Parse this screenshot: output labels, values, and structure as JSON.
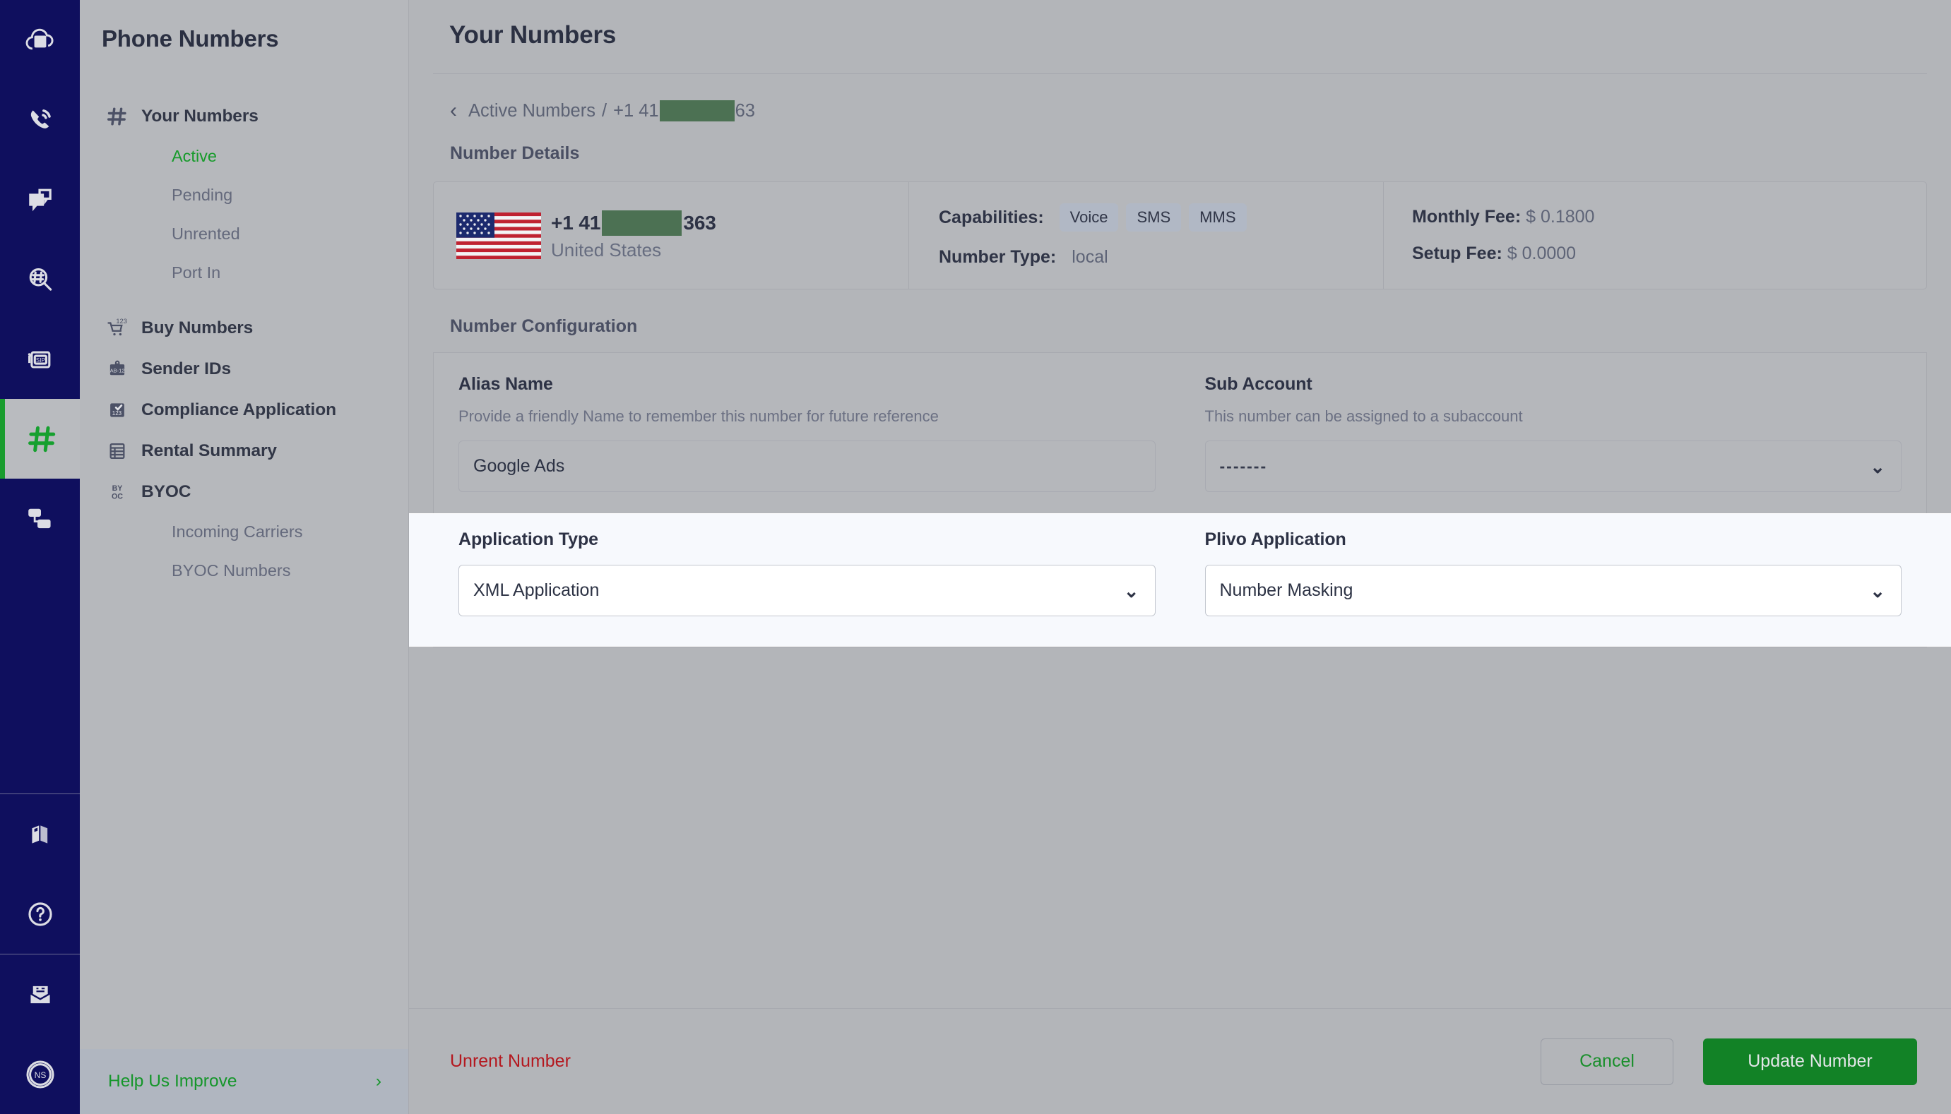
{
  "rail": {
    "items": [
      {
        "name": "cloud-keypad-icon",
        "label": "Cloud"
      },
      {
        "name": "voice-calls-icon",
        "label": "Voice"
      },
      {
        "name": "messaging-icon",
        "label": "Messaging"
      },
      {
        "name": "number-lookup-icon",
        "label": "Lookup"
      },
      {
        "name": "sip-trunking-icon",
        "label": "Zentrunk SIP"
      },
      {
        "name": "phone-numbers-icon",
        "label": "Phone Numbers"
      },
      {
        "name": "flows-icon",
        "label": "Flows"
      }
    ],
    "bottom_items": [
      {
        "name": "docs-icon",
        "label": "Docs"
      },
      {
        "name": "help-icon",
        "label": "Help"
      },
      {
        "name": "billing-icon",
        "label": "Billing"
      },
      {
        "name": "account-avatar",
        "label": "NS"
      }
    ],
    "active_index": 5,
    "accent": "#1a9c2e",
    "background": "#0f0f5e"
  },
  "sidebar": {
    "title": "Phone Numbers",
    "groups": [
      {
        "icon": "hash-icon",
        "label": "Your Numbers",
        "children": [
          {
            "label": "Active",
            "active": true
          },
          {
            "label": "Pending",
            "active": false
          },
          {
            "label": "Unrented",
            "active": false
          },
          {
            "label": "Port In",
            "active": false
          }
        ]
      },
      {
        "icon": "cart-123-icon",
        "label": "Buy Numbers",
        "children": []
      },
      {
        "icon": "sender-id-icon",
        "label": "Sender IDs",
        "children": []
      },
      {
        "icon": "compliance-123-icon",
        "label": "Compliance Application",
        "children": []
      },
      {
        "icon": "table-icon",
        "label": "Rental Summary",
        "children": []
      },
      {
        "icon": "byoc-icon",
        "label": "BYOC",
        "children": [
          {
            "label": "Incoming Carriers",
            "active": false
          },
          {
            "label": "BYOC Numbers",
            "active": false
          }
        ]
      }
    ],
    "footer": {
      "label": "Help Us Improve",
      "chevron": "›"
    }
  },
  "main": {
    "page_title": "Your Numbers",
    "breadcrumb": {
      "back_chevron": "‹",
      "parent": "Active Numbers",
      "separator": "/",
      "number_prefix": "+1 41",
      "number_suffix": "63",
      "redaction_color": "#4c7153"
    },
    "number_details": {
      "section_label": "Number Details",
      "flag_icon": "us-flag-icon",
      "number_prefix": "+1 41",
      "number_suffix": "363",
      "country": "United States",
      "capabilities_label": "Capabilities:",
      "capabilities": [
        "Voice",
        "SMS",
        "MMS"
      ],
      "number_type_label": "Number Type:",
      "number_type_value": "local",
      "monthly_fee_label": "Monthly Fee:",
      "monthly_fee_value": "$ 0.1800",
      "setup_fee_label": "Setup Fee:",
      "setup_fee_value": "$ 0.0000"
    },
    "number_configuration": {
      "section_label": "Number Configuration",
      "alias": {
        "label": "Alias Name",
        "hint": "Provide a friendly Name to remember this number for future reference",
        "value": "Google Ads",
        "placeholder": "Alias Name"
      },
      "sub_account": {
        "label": "Sub Account",
        "hint": "This number can be assigned to a subaccount",
        "value": "-------",
        "caret": "⌄"
      },
      "application_type": {
        "label": "Application Type",
        "value": "XML Application",
        "caret": "⌄"
      },
      "plivo_application": {
        "label": "Plivo Application",
        "value": "Number Masking",
        "caret": "⌄"
      }
    },
    "footer": {
      "unrent_label": "Unrent Number",
      "unrent_color": "#b4181f",
      "cancel_label": "Cancel",
      "update_label": "Update Number",
      "update_color": "#128226"
    }
  }
}
